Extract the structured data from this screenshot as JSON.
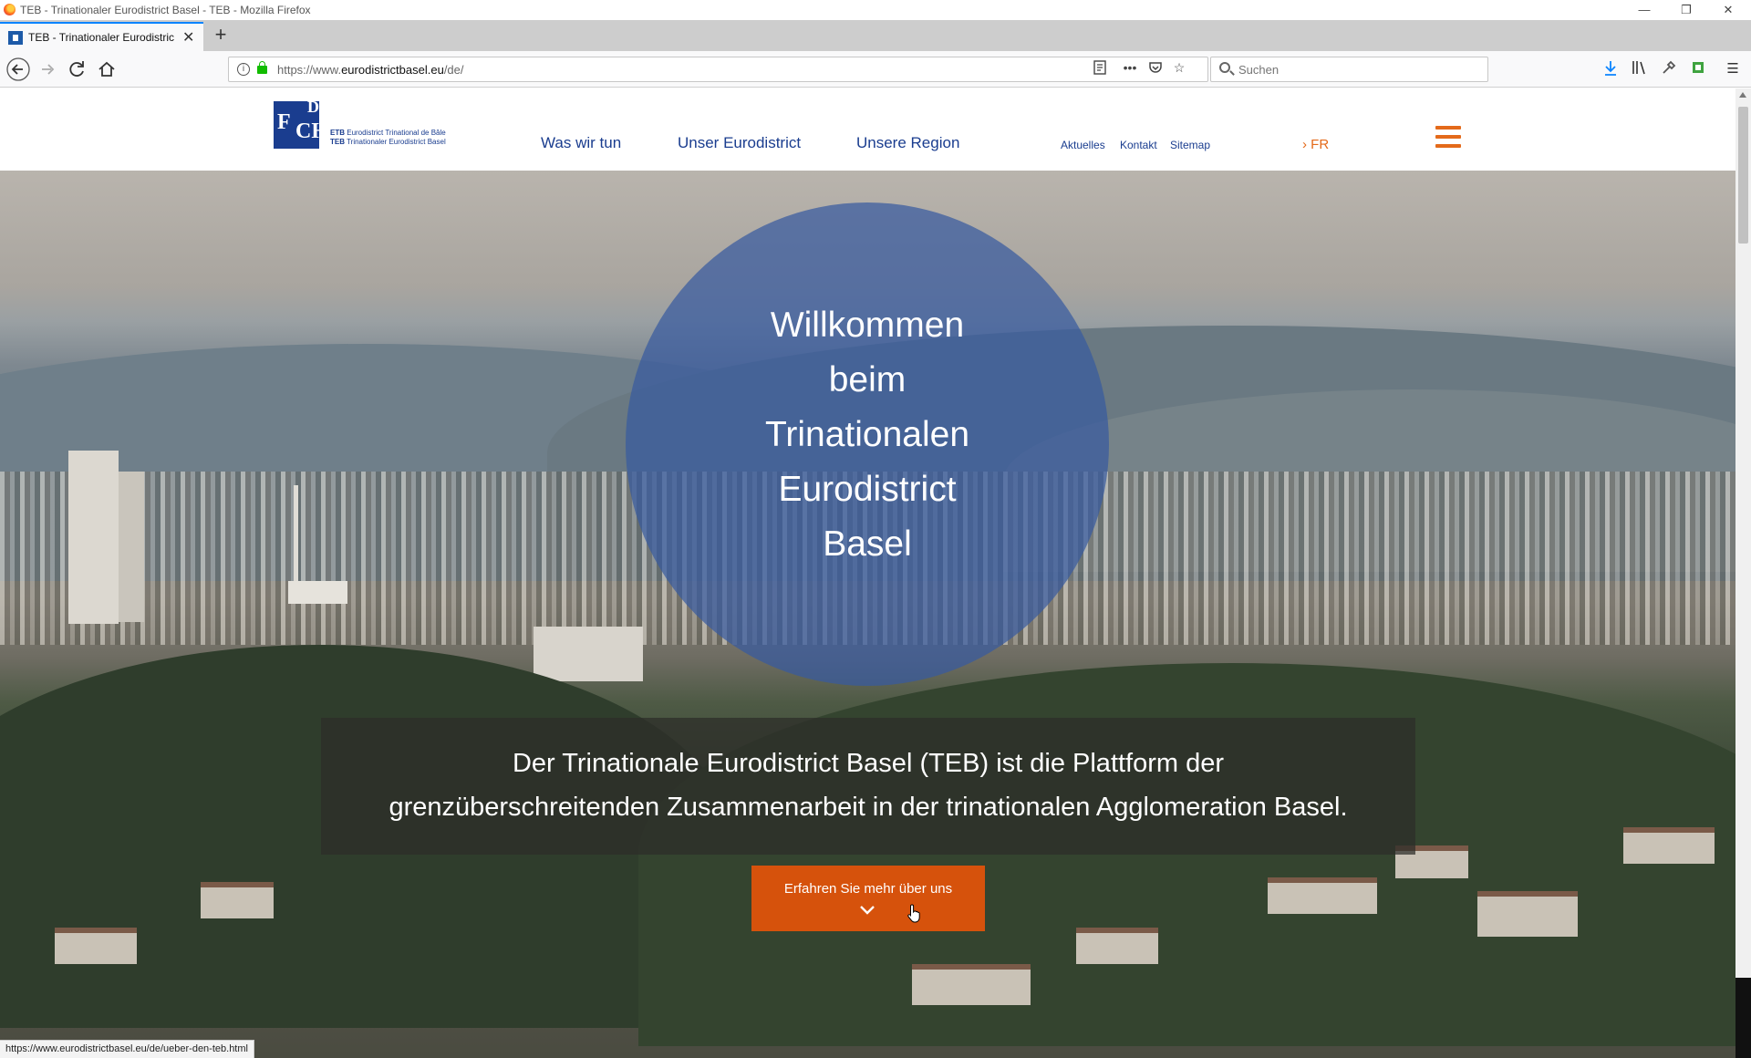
{
  "window": {
    "title": "TEB - Trinationaler Eurodistrict Basel - TEB - Mozilla Firefox",
    "minimize_icon": "minimize-icon",
    "restore_icon": "restore-icon",
    "close_icon": "close-icon"
  },
  "tab": {
    "label": "TEB - Trinationaler Eurodistrict",
    "new_tab": "+"
  },
  "toolbar": {
    "url_prefix": "https://www.",
    "url_domain": "eurodistrictbasel.eu",
    "url_path": "/de/",
    "search_placeholder": "Suchen"
  },
  "site": {
    "logo": {
      "line1_bold": "ETB",
      "line1": "Eurodistrict Trinational de Bâle",
      "line2_bold": "TEB",
      "line2": "Trinationaler Eurodistrict Basel"
    },
    "nav": {
      "items": [
        "Was wir tun",
        "Unser Eurodistrict",
        "Unsere Region"
      ],
      "sub": [
        "Aktuelles",
        "Kontakt",
        "Sitemap"
      ],
      "lang_arrow": "›",
      "lang": "FR"
    },
    "hero": {
      "welcome": [
        "Willkommen",
        "beim",
        "Trinationalen",
        "Eurodistrict",
        "Basel"
      ],
      "intro": [
        "Der Trinationale Eurodistrict Basel (TEB) ist die Plattform der",
        "grenzüberschreitenden Zusammenarbeit in der trinationalen Agglomeration Basel."
      ],
      "cta_label": "Erfahren Sie mehr über uns"
    },
    "colors": {
      "brand_blue": "#1a3d8f",
      "accent_orange": "#e46a1a",
      "cta_orange": "#d6520c"
    }
  },
  "status": {
    "url": "https://www.eurodistrictbasel.eu/de/ueber-den-teb.html"
  }
}
